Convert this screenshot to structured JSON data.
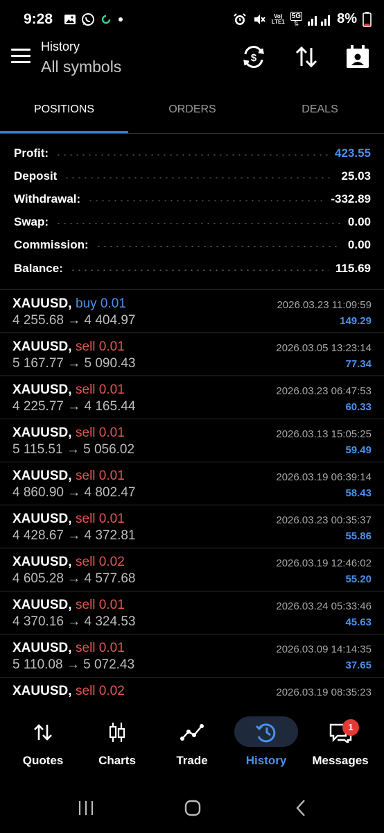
{
  "status_bar": {
    "time": "9:28",
    "battery": "8%",
    "network_label_top": "Vo)",
    "network_label_bottom": "LTE1",
    "fiveg": "5G",
    "icons": [
      "gallery-icon",
      "whatsapp-icon",
      "sync-icon",
      "dot-icon",
      "alarm-icon",
      "mute-icon",
      "signal-icon",
      "battery-icon"
    ]
  },
  "app_bar": {
    "title": "History",
    "subtitle": "All symbols",
    "icons": [
      "menu-icon",
      "currency-refresh-icon",
      "sort-icon",
      "calendar-person-icon"
    ]
  },
  "tabs": [
    {
      "label": "POSITIONS",
      "active": true
    },
    {
      "label": "ORDERS",
      "active": false
    },
    {
      "label": "DEALS",
      "active": false
    }
  ],
  "summary": {
    "profit": {
      "label": "Profit:",
      "value": "423.55"
    },
    "deposit": {
      "label": "Deposit",
      "value": "25.03"
    },
    "withdrawal": {
      "label": "Withdrawal:",
      "value": "-332.89"
    },
    "swap": {
      "label": "Swap:",
      "value": "0.00"
    },
    "commission": {
      "label": "Commission:",
      "value": "0.00"
    },
    "balance": {
      "label": "Balance:",
      "value": "115.69"
    }
  },
  "deals": [
    {
      "symbol": "XAUUSD,",
      "side": "buy 0.01",
      "type": "buy",
      "prices": "4 255.68 → 4 404.97",
      "time": "2026.03.23 11:09:59",
      "profit": "149.29"
    },
    {
      "symbol": "XAUUSD,",
      "side": "sell 0.01",
      "type": "sell",
      "prices": "5 167.77 → 5 090.43",
      "time": "2026.03.05 13:23:14",
      "profit": "77.34"
    },
    {
      "symbol": "XAUUSD,",
      "side": "sell 0.01",
      "type": "sell",
      "prices": "4 225.77 → 4 165.44",
      "time": "2026.03.23 06:47:53",
      "profit": "60.33"
    },
    {
      "symbol": "XAUUSD,",
      "side": "sell 0.01",
      "type": "sell",
      "prices": "5 115.51 → 5 056.02",
      "time": "2026.03.13 15:05:25",
      "profit": "59.49"
    },
    {
      "symbol": "XAUUSD,",
      "side": "sell 0.01",
      "type": "sell",
      "prices": "4 860.90 → 4 802.47",
      "time": "2026.03.19 06:39:14",
      "profit": "58.43"
    },
    {
      "symbol": "XAUUSD,",
      "side": "sell 0.01",
      "type": "sell",
      "prices": "4 428.67 → 4 372.81",
      "time": "2026.03.23 00:35:37",
      "profit": "55.86"
    },
    {
      "symbol": "XAUUSD,",
      "side": "sell 0.02",
      "type": "sell",
      "prices": "4 605.28 → 4 577.68",
      "time": "2026.03.19 12:46:02",
      "profit": "55.20"
    },
    {
      "symbol": "XAUUSD,",
      "side": "sell 0.01",
      "type": "sell",
      "prices": "4 370.16 → 4 324.53",
      "time": "2026.03.24 05:33:46",
      "profit": "45.63"
    },
    {
      "symbol": "XAUUSD,",
      "side": "sell 0.01",
      "type": "sell",
      "prices": "5 110.08 → 5 072.43",
      "time": "2026.03.09 14:14:35",
      "profit": "37.65"
    },
    {
      "symbol": "XAUUSD,",
      "side": "sell 0.02",
      "type": "sell",
      "prices": "",
      "time": "2026.03.19 08:35:23",
      "profit": ""
    }
  ],
  "bottom_nav": [
    {
      "label": "Quotes",
      "icon": "quotes-icon",
      "active": false
    },
    {
      "label": "Charts",
      "icon": "candlestick-icon",
      "active": false
    },
    {
      "label": "Trade",
      "icon": "trade-line-icon",
      "active": false
    },
    {
      "label": "History",
      "icon": "history-icon",
      "active": true
    },
    {
      "label": "Messages",
      "icon": "messages-icon",
      "active": false,
      "badge": "1"
    }
  ],
  "colors": {
    "accent": "#4a90e8",
    "sell": "#e25555",
    "background": "#000000"
  }
}
